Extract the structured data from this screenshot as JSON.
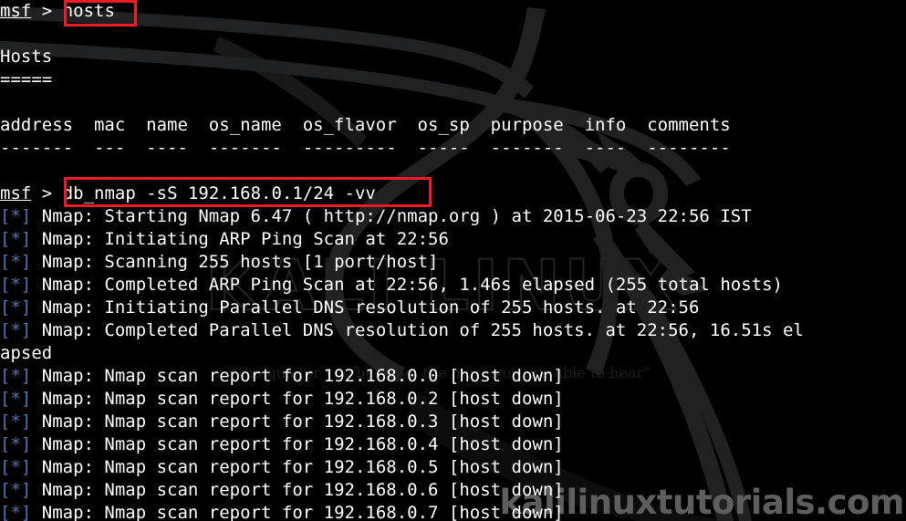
{
  "terminal": {
    "prompt_label": "msf",
    "prompt_symbol": ">",
    "info_prefix": "[*]",
    "background_color": "#000000",
    "text_color": "#ffffff",
    "info_prefix_color": "#4f76ae",
    "highlight_box_color": "#ee1c24"
  },
  "command_1": "hosts",
  "command_2": "db_nmap -sS 192.168.0.1/24 -vv",
  "hosts_output": {
    "title": "Hosts",
    "title_underline": "=====",
    "columns": [
      "address",
      "mac",
      "name",
      "os_name",
      "os_flavor",
      "os_sp",
      "purpose",
      "info",
      "comments"
    ],
    "header_line": "address  mac  name  os_name  os_flavor  os_sp  purpose  info  comments",
    "dash_line": "-------  ---  ----  -------  ---------  -----  -------  ----  --------"
  },
  "nmap_lines": [
    "Nmap: Starting Nmap 6.47 ( http://nmap.org ) at 2015-06-23 22:56 IST",
    "Nmap: Initiating ARP Ping Scan at 22:56",
    "Nmap: Scanning 255 hosts [1 port/host]",
    "Nmap: Completed ARP Ping Scan at 22:56, 1.46s elapsed (255 total hosts)",
    "Nmap: Initiating Parallel DNS resolution of 255 hosts. at 22:56",
    "Nmap: Completed Parallel DNS resolution of 255 hosts. at 22:56, 16.51s el"
  ],
  "wrapped_continuation": "apsed",
  "scan_reports": [
    "Nmap: Nmap scan report for 192.168.0.0 [host down]",
    "Nmap: Nmap scan report for 192.168.0.2 [host down]",
    "Nmap: Nmap scan report for 192.168.0.3 [host down]",
    "Nmap: Nmap scan report for 192.168.0.4 [host down]",
    "Nmap: Nmap scan report for 192.168.0.5 [host down]",
    "Nmap: Nmap scan report for 192.168.0.6 [host down]",
    "Nmap: Nmap scan report for 192.168.0.7 [host down]"
  ],
  "watermarks": {
    "site_brand": "kalilinuxtutorials.com",
    "kali_wordmark": "KALI LINUX",
    "kali_quote": "“the quieter you become, the more you are able to hear”"
  }
}
